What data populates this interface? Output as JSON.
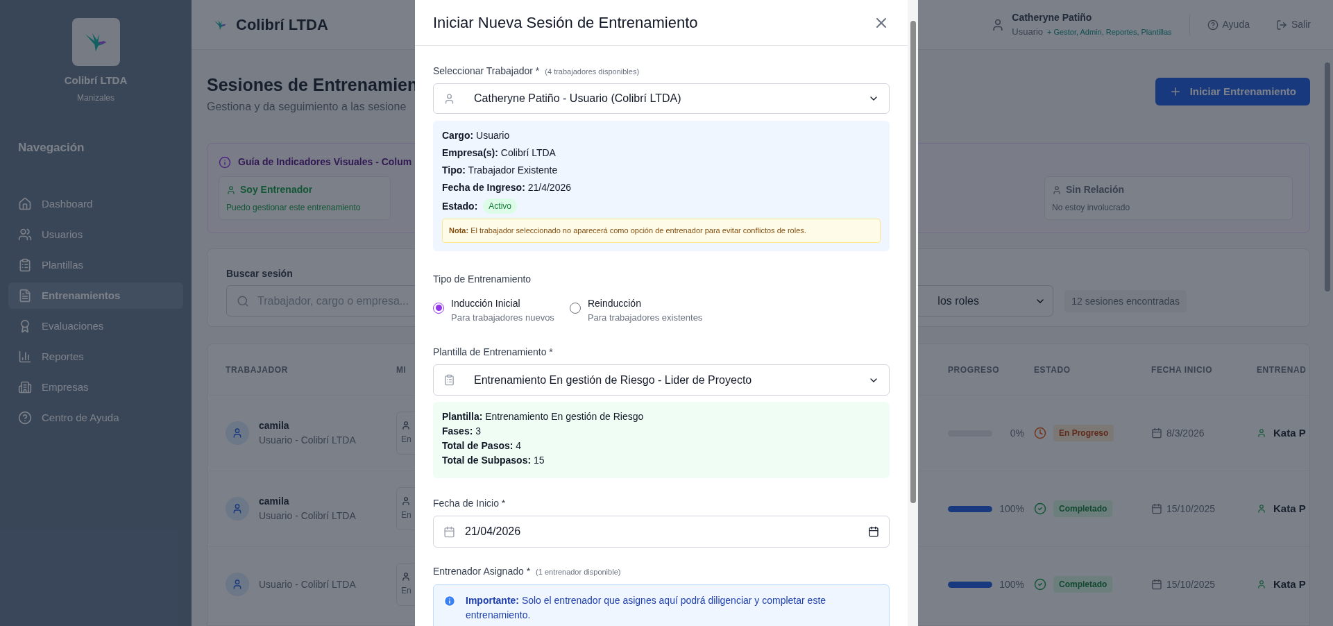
{
  "sidebar": {
    "brand": "Colibrí LTDA",
    "city": "Manizales",
    "section_title": "Navegación",
    "items": [
      {
        "label": "Dashboard",
        "selected": false
      },
      {
        "label": "Usuarios",
        "selected": false
      },
      {
        "label": "Plantillas",
        "selected": false
      },
      {
        "label": "Entrenamientos",
        "selected": true
      },
      {
        "label": "Evaluaciones",
        "selected": false
      },
      {
        "label": "Reportes",
        "selected": false
      },
      {
        "label": "Empresas",
        "selected": false
      },
      {
        "label": "Centro de Ayuda",
        "selected": false
      }
    ]
  },
  "header": {
    "brand": "Colibrí LTDA",
    "user_name": "Catheryne Patiño",
    "user_role": "Usuario",
    "extra_roles": "+ Gestor, Admin, Reportes, Plantillas",
    "help": "Ayuda",
    "logout": "Salir"
  },
  "page": {
    "title": "Sesiones de Entrenamien",
    "subtitle": "Gestiona y da seguimiento a las sesione",
    "primary_button": "Iniciar Entrenamiento"
  },
  "guide": {
    "title": "Guía de Indicadores Visuales - Colum",
    "indicators": [
      {
        "title": "Soy Entrenador",
        "description": "Puedo gestionar este entrenamiento",
        "kind": "trainer"
      },
      {
        "title": "Sin Relación",
        "description": "No estoy involucrado",
        "kind": "none"
      }
    ]
  },
  "filters": {
    "search_label": "Buscar sesión",
    "search_placeholder": "Trabajador, cargo o empresa...",
    "role_filter": "los roles",
    "result_count": "12 sesiones encontradas"
  },
  "table": {
    "columns": [
      "TRABAJADOR",
      "MI",
      "PROGRESO",
      "ESTADO",
      "FECHA INICIO",
      "ENTRENAD"
    ],
    "rows": [
      {
        "name": "camila",
        "subtitle": "Usuario - Colibrí LTDA",
        "role": "En",
        "level": 0,
        "progress": "0%",
        "status": "En Progreso",
        "kind": "in_progress",
        "date": "8/3/2026",
        "trainer": "Kata P"
      },
      {
        "name": "camila",
        "subtitle": "Usuario - Colibrí LTDA",
        "role": "En",
        "level": 1,
        "progress": "100%",
        "status": "Completado",
        "kind": "completed",
        "date": "15/10/2025",
        "trainer": "Kata P"
      },
      {
        "subtitle": "Usuario - Colibrí LTDA",
        "role": "En",
        "level": 1,
        "progress": "100%",
        "status": "Completado",
        "kind": "completed",
        "date": "15/10/2025",
        "trainer": "Kata P"
      }
    ]
  },
  "modal": {
    "title": "Iniciar Nueva Sesión de Entrenamiento",
    "worker_label": "Seleccionar Trabajador *",
    "worker_hint": "(4 trabajadores disponibles)",
    "worker_value": "Catheryne Patiño - Usuario (Colibrí LTDA)",
    "worker_info": [
      {
        "label": "Cargo:",
        "value": "Usuario"
      },
      {
        "label": "Empresa(s):",
        "value": "Colibrí LTDA"
      },
      {
        "label": "Tipo:",
        "value": "Trabajador Existente"
      },
      {
        "label": "Fecha de Ingreso:",
        "value": "21/4/2026"
      }
    ],
    "worker_status": {
      "label": "Estado:",
      "value": "Activo"
    },
    "note": "**Nota:** El trabajador seleccionado no aparecerá como opción de entrenador para evitar conflictos de roles.",
    "type_label": "Tipo de Entrenamiento",
    "type_options": [
      {
        "title": "Inducción Inicial",
        "description": "Para trabajadores nuevos",
        "selected": true
      },
      {
        "title": "Reinducción",
        "description": "Para trabajadores existentes",
        "selected": false
      }
    ],
    "template_label": "Plantilla de Entrenamiento *",
    "template_value": "Entrenamiento En gestión de Riesgo - Lider de Proyecto",
    "template_info": [
      {
        "label": "Plantilla:",
        "value": "Entrenamiento En gestión de Riesgo"
      },
      {
        "label": "Fases:",
        "value": "3"
      },
      {
        "label": "Total de Pasos:",
        "value": "4"
      },
      {
        "label": "Total de Subpasos:",
        "value": "15"
      }
    ],
    "date_label": "Fecha de Inicio *",
    "date_value": "21/04/2026",
    "trainer_label": "Entrenador Asignado *",
    "trainer_hint": "(1 entrenador disponible)",
    "important": "**Importante:** Solo el entrenador que asignes aquí podrá diligenciar y completar este entrenamiento."
  }
}
